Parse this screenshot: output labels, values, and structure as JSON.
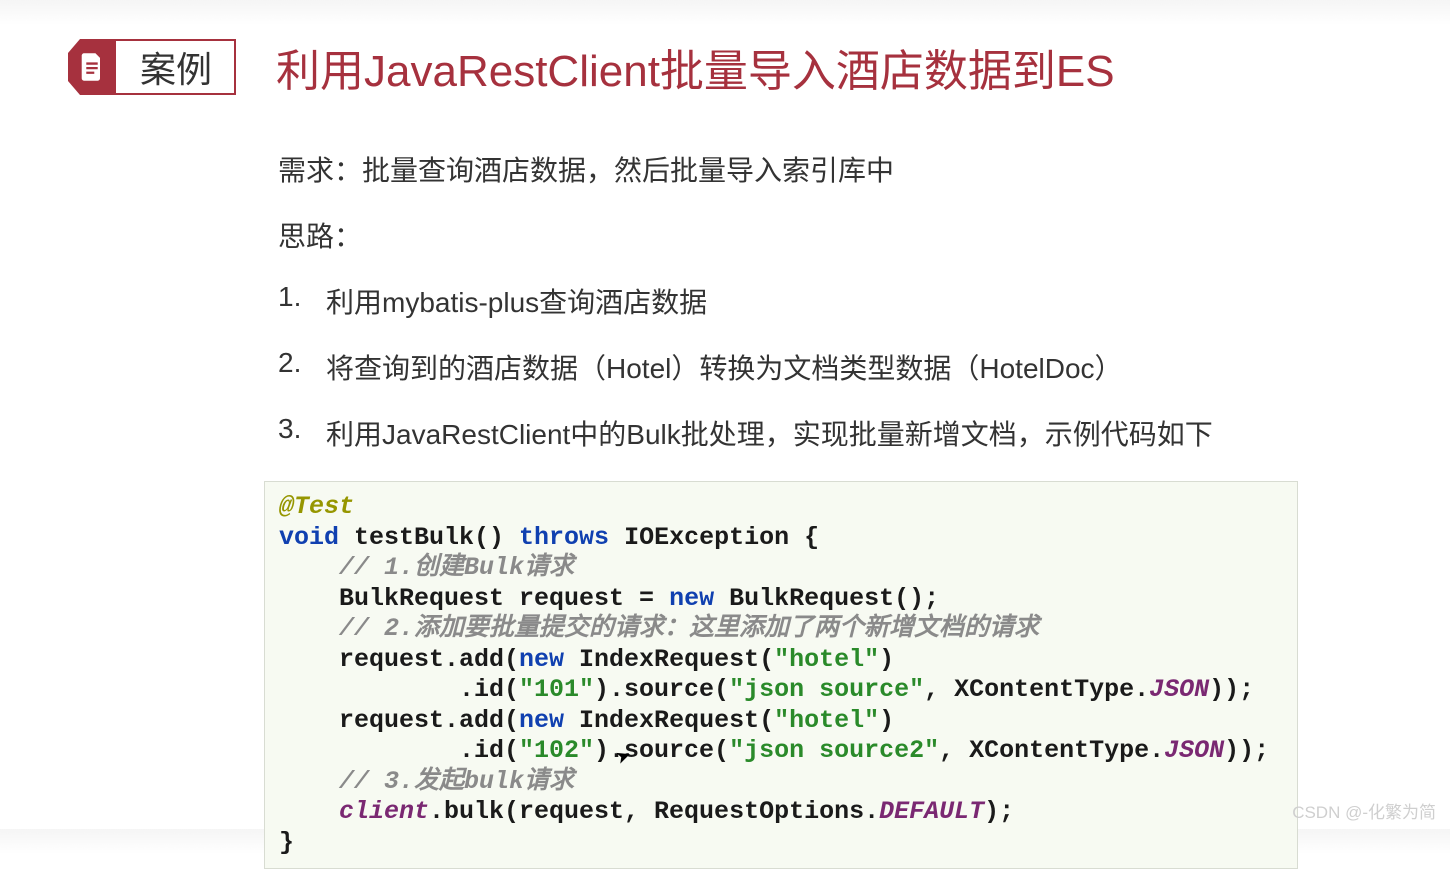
{
  "header": {
    "badge_label": "案例",
    "title": "利用JavaRestClient批量导入酒店数据到ES"
  },
  "body": {
    "requirement_label": "需求：批量查询酒店数据，然后批量导入索引库中",
    "approach_label": "思路：",
    "steps": [
      "利用mybatis-plus查询酒店数据",
      "将查询到的酒店数据（Hotel）转换为文档类型数据（HotelDoc）",
      "利用JavaRestClient中的Bulk批处理，实现批量新增文档，示例代码如下"
    ]
  },
  "code": {
    "anno": "@Test",
    "kw_void": "void",
    "fn_name": " testBulk() ",
    "kw_throws": "throws",
    "exc": " IOException {",
    "c1": "// 1.创建Bulk请求",
    "l1a": "BulkRequest request = ",
    "kw_new": "new",
    "l1b": " BulkRequest();",
    "c2": "// 2.添加要批量提交的请求：这里添加了两个新增文档的请求",
    "l2a": "request.add(",
    "l2b": " IndexRequest(",
    "str_hotel": "\"hotel\"",
    "l2c": ")",
    "l3a": ".id(",
    "str_101": "\"101\"",
    "l3b": ").source(",
    "str_js1": "\"json source\"",
    "l3c": ", XContentType.",
    "fld_json": "JSON",
    "l3d": "));",
    "str_102": "\"102\"",
    "str_js2": "\"json source2\"",
    "c3": "// 3.发起bulk请求",
    "l5a": "client",
    "l5b": ".bulk(request, RequestOptions.",
    "fld_def": "DEFAULT",
    "l5c": ");",
    "close": "}"
  },
  "watermark": "CSDN @-化繁为简"
}
